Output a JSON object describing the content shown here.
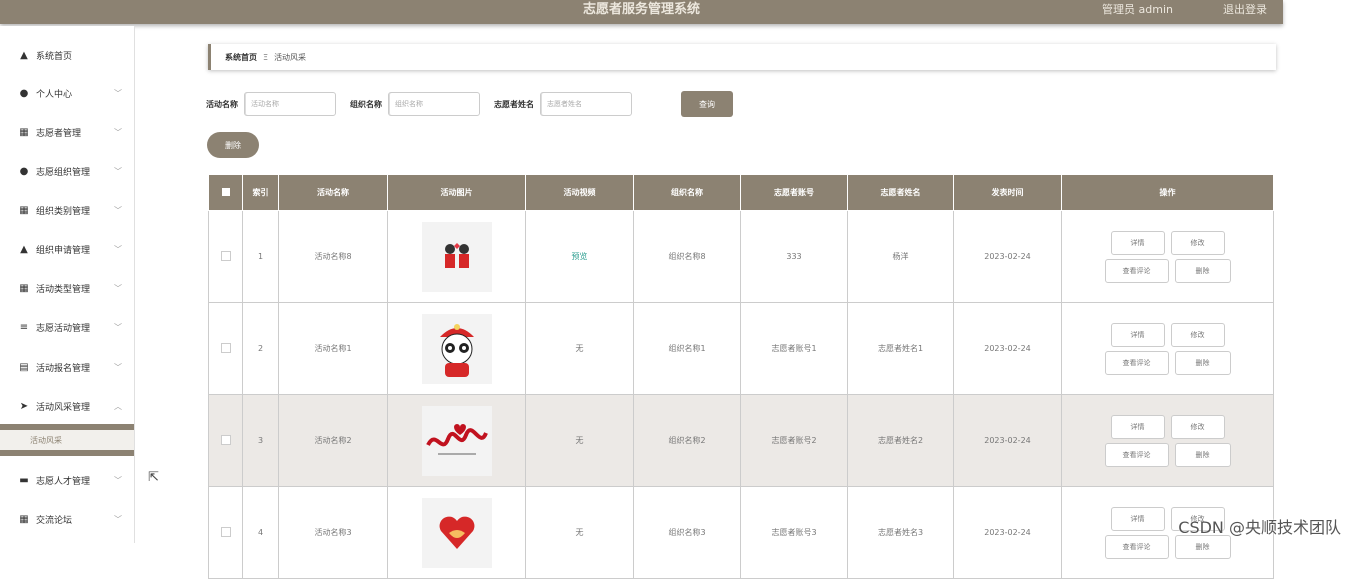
{
  "header": {
    "title": "志愿者服务管理系统",
    "user": "管理员 admin",
    "logout": "退出登录"
  },
  "sidebar": {
    "items": [
      {
        "label": "系统首页",
        "icon": "home-icon",
        "glyph": "▲"
      },
      {
        "label": "个人中心",
        "icon": "user-icon",
        "glyph": "●"
      },
      {
        "label": "志愿者管理",
        "icon": "grid-icon",
        "glyph": "▦"
      },
      {
        "label": "志愿组织管理",
        "icon": "location-icon",
        "glyph": "●"
      },
      {
        "label": "组织类别管理",
        "icon": "grid-icon",
        "glyph": "▦"
      },
      {
        "label": "组织申请管理",
        "icon": "thumb-icon",
        "glyph": "▲"
      },
      {
        "label": "活动类型管理",
        "icon": "grid-icon",
        "glyph": "▦"
      },
      {
        "label": "志愿活动管理",
        "icon": "list-icon",
        "glyph": "≡"
      },
      {
        "label": "活动报名管理",
        "icon": "doc-icon",
        "glyph": "▤"
      },
      {
        "label": "活动风采管理",
        "icon": "send-icon",
        "glyph": "➤"
      },
      {
        "label": "志愿人才管理",
        "icon": "card-icon",
        "glyph": "▬"
      },
      {
        "label": "交流论坛",
        "icon": "grid-icon",
        "glyph": "▦"
      }
    ],
    "sub_active": "活动风采"
  },
  "breadcrumb": {
    "home": "系统首页",
    "sep": "Ξ",
    "current": "活动风采"
  },
  "search": {
    "activity_label": "活动名称",
    "activity_placeholder": "活动名称",
    "org_label": "组织名称",
    "org_placeholder": "组织名称",
    "volunteer_label": "志愿者姓名",
    "volunteer_placeholder": "志愿者姓名",
    "query_button": "查询"
  },
  "delete_button": "删除",
  "table": {
    "headers": [
      "索引",
      "活动名称",
      "活动图片",
      "活动视频",
      "组织名称",
      "志愿者账号",
      "志愿者姓名",
      "发表时间",
      "操作"
    ],
    "rows": [
      {
        "index": "1",
        "name": "活动名称8",
        "video": "预览",
        "org": "组织名称8",
        "account": "333",
        "vname": "杨洋",
        "time": "2023-02-24",
        "pic": "volunteers"
      },
      {
        "index": "2",
        "name": "活动名称1",
        "video": "无",
        "org": "组织名称1",
        "account": "志愿者账号1",
        "vname": "志愿者姓名1",
        "time": "2023-02-24",
        "pic": "panda"
      },
      {
        "index": "3",
        "name": "活动名称2",
        "video": "无",
        "org": "组织名称2",
        "account": "志愿者账号2",
        "vname": "志愿者姓名2",
        "time": "2023-02-24",
        "pic": "calligraphy"
      },
      {
        "index": "4",
        "name": "活动名称3",
        "video": "无",
        "org": "组织名称3",
        "account": "志愿者账号3",
        "vname": "志愿者姓名3",
        "time": "2023-02-24",
        "pic": "heart-hand"
      }
    ],
    "ops": {
      "detail": "详情",
      "edit": "修改",
      "comments": "查看评论",
      "delete": "删除"
    }
  },
  "watermark": "CSDN @央顺技术团队",
  "colors": {
    "accent": "#8c8272",
    "alt_row": "#ece9e6"
  }
}
